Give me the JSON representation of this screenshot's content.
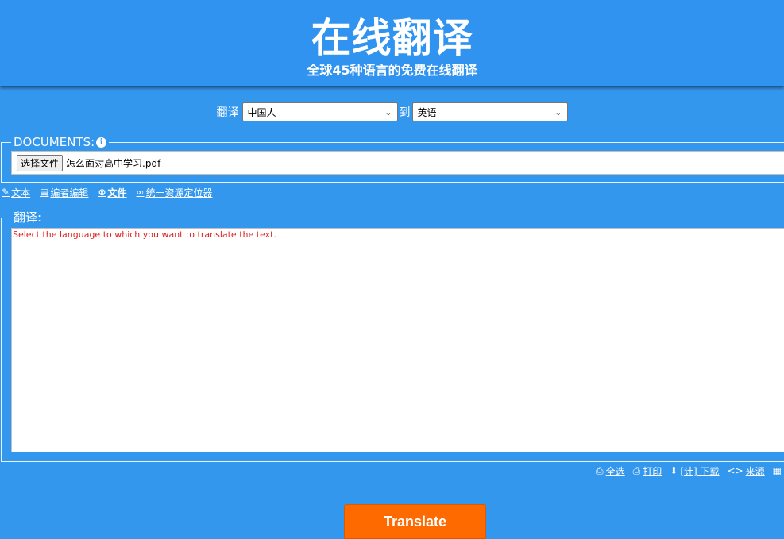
{
  "header": {
    "title": "在线翻译",
    "subtitle": "全球45种语言的免费在线翻译"
  },
  "language_bar": {
    "label_translate": "翻译",
    "from_value": "中国人",
    "label_to": "到",
    "to_value": "英语"
  },
  "documents": {
    "legend": "DOCUMENTS:",
    "info_icon": "i",
    "file_button": "选择文件",
    "file_name": "怎么面对高中学习.pdf"
  },
  "tabs": [
    {
      "label": "文本",
      "icon": "edit-icon"
    },
    {
      "label": "编者编辑",
      "icon": "document-icon"
    },
    {
      "label": "文件",
      "icon": "paperclip-icon"
    },
    {
      "label": "统一资源定位器",
      "icon": "link-icon"
    }
  ],
  "translation": {
    "legend": "翻译:",
    "message": "Select the language to which you want to translate the text."
  },
  "actions": [
    {
      "label": "全选",
      "icon": "clipboard-icon"
    },
    {
      "label": "打印",
      "icon": "printer-icon"
    },
    {
      "label": "[计] 下载",
      "icon": "download-icon"
    },
    {
      "label": "来源",
      "icon": "code-icon"
    }
  ],
  "translate_button": "Translate",
  "colors": {
    "background": "#3497ee",
    "header": "#2f93ef",
    "button": "#ff6a00",
    "message": "#e02020"
  }
}
